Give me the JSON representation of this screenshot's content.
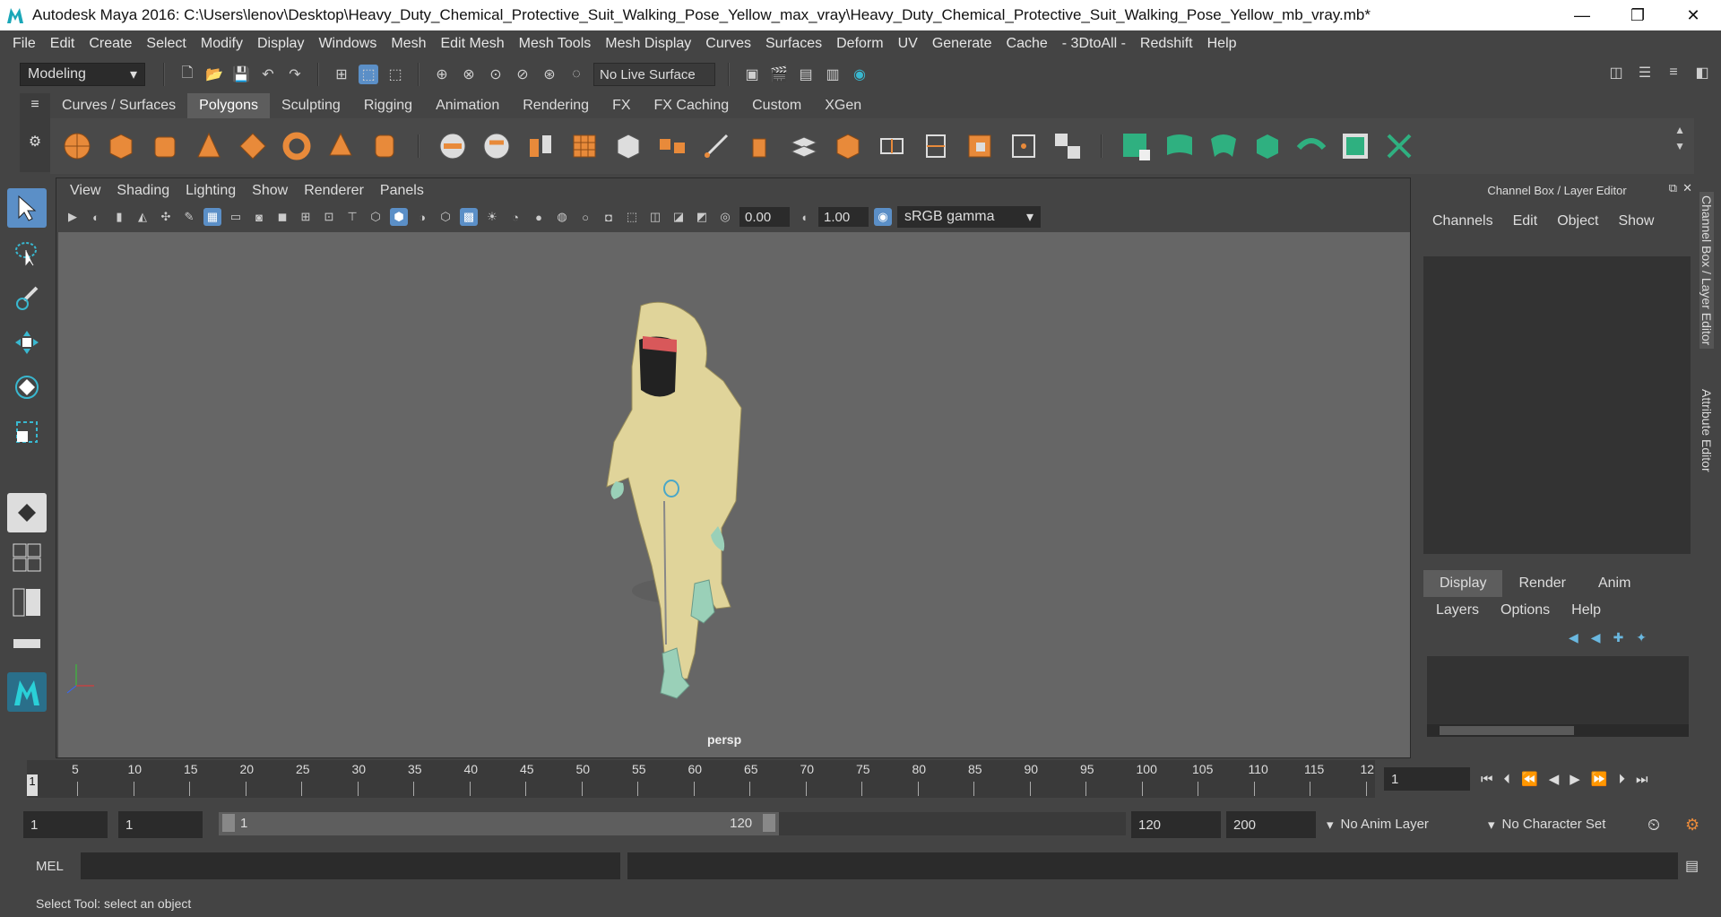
{
  "window": {
    "title": "Autodesk Maya 2016: C:\\Users\\lenov\\Desktop\\Heavy_Duty_Chemical_Protective_Suit_Walking_Pose_Yellow_max_vray\\Heavy_Duty_Chemical_Protective_Suit_Walking_Pose_Yellow_mb_vray.mb*",
    "minimize": "—",
    "restore": "❐",
    "close": "✕"
  },
  "menubar": [
    "File",
    "Edit",
    "Create",
    "Select",
    "Modify",
    "Display",
    "Windows",
    "Mesh",
    "Edit Mesh",
    "Mesh Tools",
    "Mesh Display",
    "Curves",
    "Surfaces",
    "Deform",
    "UV",
    "Generate",
    "Cache",
    "- 3DtoAll -",
    "Redshift",
    "Help"
  ],
  "statusline": {
    "mode": "Modeling",
    "live_surface": "No Live Surface"
  },
  "shelf": {
    "tabs": [
      "Curves / Surfaces",
      "Polygons",
      "Sculpting",
      "Rigging",
      "Animation",
      "Rendering",
      "FX",
      "FX Caching",
      "Custom",
      "XGen"
    ],
    "active": "Polygons"
  },
  "viewport": {
    "menu": [
      "View",
      "Shading",
      "Lighting",
      "Show",
      "Renderer",
      "Panels"
    ],
    "exposure": "0.00",
    "gamma_value": "1.00",
    "color_space": "sRGB gamma",
    "camera_label": "persp"
  },
  "channelbox": {
    "title": "Channel Box / Layer Editor",
    "menu": [
      "Channels",
      "Edit",
      "Object",
      "Show"
    ],
    "layer_tabs": [
      "Display",
      "Render",
      "Anim"
    ],
    "active_layer_tab": "Display",
    "layer_menu": [
      "Layers",
      "Options",
      "Help"
    ]
  },
  "side_tabs": [
    "Channel Box / Layer Editor",
    "Attribute Editor"
  ],
  "timeline": {
    "labels": [
      "5",
      "10",
      "15",
      "20",
      "25",
      "30",
      "35",
      "40",
      "45",
      "50",
      "55",
      "60",
      "65",
      "70",
      "75",
      "80",
      "85",
      "90",
      "95",
      "100",
      "105",
      "110",
      "115",
      "12"
    ],
    "current_frame_marker": "1",
    "current_frame": "1"
  },
  "range": {
    "start": "1",
    "playback_start": "1",
    "slider_start": "1",
    "slider_end": "120",
    "playback_end": "120",
    "end": "200",
    "anim_layer": "No Anim Layer",
    "char_set": "No Character Set"
  },
  "command": {
    "lang": "MEL"
  },
  "help": {
    "text": "Select Tool: select an object"
  }
}
